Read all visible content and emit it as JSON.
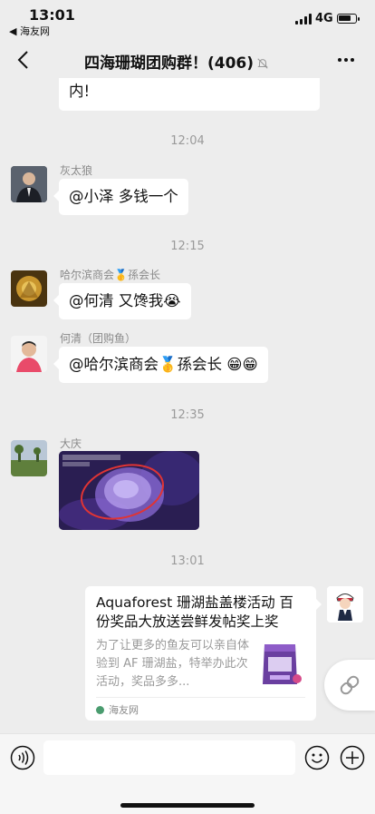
{
  "status_bar": {
    "time": "13:01",
    "back_app": "◀ 海友网",
    "network": "4G"
  },
  "nav": {
    "title": "四海珊瑚团购群！(406)"
  },
  "messages": {
    "partial_text": "内!",
    "ts1": "12:04",
    "msg1_sender": "灰太狼",
    "msg1_text": "@小泽 多钱一个",
    "ts2": "12:15",
    "msg2_sender": "哈尔滨商会🥇孫会长",
    "msg2_text": "@何清 又馋我😭",
    "msg3_sender": "何清（团购鱼）",
    "msg3_text": "@哈尔滨商会🥇孫会长 😁😁",
    "ts3": "12:35",
    "msg4_sender": "大庆",
    "ts4": "13:01"
  },
  "link_card": {
    "title": "Aquaforest 珊湖盐盖楼活动 百份奖品大放送尝鲜发帖奖上奖",
    "description": "为了让更多的鱼友可以亲自体验到 AF 珊湖盐，特举办此次活动，奖品多多...",
    "source": "海友网"
  },
  "colors": {
    "background": "#ededed",
    "bubble": "#ffffff",
    "timestamp": "#9a9a9a"
  }
}
